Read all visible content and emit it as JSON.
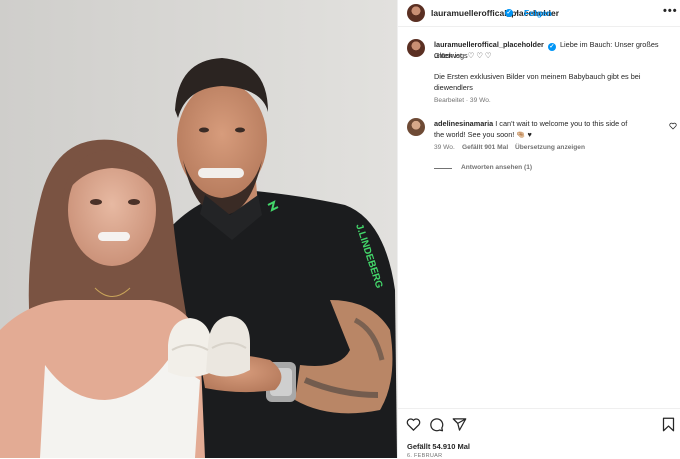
{
  "post": {
    "username": "lauramuelleroffical_placeholder",
    "follow_label": "Folgen",
    "more_label": "•••"
  },
  "caption": {
    "username": "lauramuelleroffical_placeholder",
    "line1": "Liebe im Bauch: Unser großes Glück ist",
    "line2": "unterwegs♡ ♡ ♡",
    "line3": "Die Ersten exklusiven Bilder von meinem Babybauch gibt es bei",
    "line4": "diewendlers",
    "edited": "Bearbeitet · 39 Wo."
  },
  "comment": {
    "username": "adelinesinamaria",
    "text1": "I can't wait to welcome you to this side of",
    "text2": "the world! See you soon! 🤏🏼 ♥",
    "time": "39 Wo.",
    "likes": "Gefällt 901 Mal",
    "translate": "Übersetzung anzeigen",
    "replies": "Antworten ansehen (1)"
  },
  "footer": {
    "likes": "Gefällt 54.910 Mal",
    "date": "6. FEBRUAR"
  },
  "icons": [
    "heart-icon",
    "comment-icon",
    "share-icon",
    "bookmark-icon",
    "verified-icon"
  ],
  "colors": {
    "accent": "#0095f6",
    "text": "#262626",
    "muted": "#737373"
  }
}
